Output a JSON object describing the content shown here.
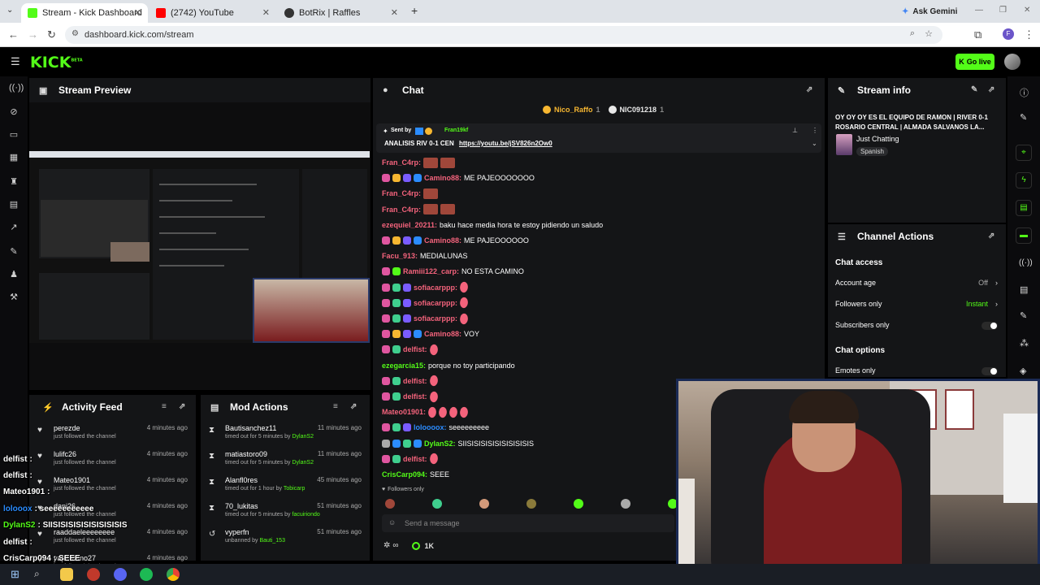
{
  "browser": {
    "tabs": [
      {
        "label": "Stream - Kick Dashboard",
        "color": "#53fc18"
      },
      {
        "label": "(2742) YouTube",
        "color": "#ff0000"
      },
      {
        "label": "BotRix | Raffles",
        "color": "#333333"
      }
    ],
    "new_tab": "+",
    "ask_gemini": "Ask Gemini",
    "url": "dashboard.kick.com/stream"
  },
  "header": {
    "logo": "KICK",
    "logo_beta": "BETA",
    "go_live": "Go live"
  },
  "preview": {
    "title": "Stream Preview"
  },
  "activity": {
    "title": "Activity Feed",
    "items": [
      {
        "name": "perezde",
        "sub": "just followed the channel",
        "time": "4 minutes ago"
      },
      {
        "name": "lulifc26",
        "sub": "just followed the channel",
        "time": "4 minutes ago"
      },
      {
        "name": "Mateo1901",
        "sub": "just followed the channel",
        "time": "4 minutes ago"
      },
      {
        "name": "dani26",
        "sub": "just followed the channel",
        "time": "4 minutes ago"
      },
      {
        "name": "raaddaeleeeeeeee",
        "sub": "just followed the channel",
        "time": "4 minutes ago"
      },
      {
        "name": "yapemano27",
        "sub": "just followed the channel",
        "time": "4 minutes ago"
      }
    ]
  },
  "mod": {
    "title": "Mod Actions",
    "items": [
      {
        "name": "Bautisanchez11",
        "sub": "timed out for 5 minutes by",
        "who": "DylanS2",
        "time": "11 minutes ago",
        "icon": "⧗"
      },
      {
        "name": "matiastoro09",
        "sub": "timed out for 5 minutes by",
        "who": "DylanS2",
        "time": "11 minutes ago",
        "icon": "⧗"
      },
      {
        "name": "Alanfl0res",
        "sub": "timed out for 1 hour by",
        "who": "Tobicarp",
        "time": "45 minutes ago",
        "icon": "⧗"
      },
      {
        "name": "70_lukitas",
        "sub": "timed out for 5 minutes by",
        "who": "facuiriondo",
        "time": "51 minutes ago",
        "icon": "⧗"
      },
      {
        "name": "vyperfn",
        "sub": "unbanned by",
        "who": "Bauti_153",
        "time": "51 minutes ago",
        "icon": "↺"
      }
    ]
  },
  "chat": {
    "title": "Chat",
    "top_gifters": [
      {
        "name": "Nico_Raffo",
        "count": "1",
        "color": "#f7b731"
      },
      {
        "name": "NIC091218",
        "count": "1",
        "color": "#e8e8e8"
      }
    ],
    "pinned": {
      "sent_by": "Sent by",
      "author": "Fran19kf",
      "text": "ANALISIS RIV 0-1 CEN",
      "link": "https://youtu.be/jSV826n2Ow0"
    },
    "messages": [
      {
        "user": "Fran_C4rp:",
        "color": "#f4637c",
        "text": "",
        "badges": [],
        "emotes": 2
      },
      {
        "user": "Camino88:",
        "color": "#f4637c",
        "text": "ME PAJEOOOOOOO",
        "badges": [
          "#e056a0",
          "#f7b731",
          "#7a5cff",
          "#2b8cff"
        ],
        "emotes": 0
      },
      {
        "user": "Fran_C4rp:",
        "color": "#f4637c",
        "text": "",
        "badges": [],
        "emotes": 1
      },
      {
        "user": "Fran_C4rp:",
        "color": "#f4637c",
        "text": "",
        "badges": [],
        "emotes": 2
      },
      {
        "user": "ezequiel_20211:",
        "color": "#f4637c",
        "text": "baku hace media hora te estoy pidiendo un saludo",
        "badges": [],
        "emotes": 0
      },
      {
        "user": "Camino88:",
        "color": "#f4637c",
        "text": "ME PAJEOOOOOO",
        "badges": [
          "#e056a0",
          "#f7b731",
          "#7a5cff",
          "#2b8cff"
        ],
        "emotes": 0
      },
      {
        "user": "Facu_913:",
        "color": "#f4637c",
        "text": "MEDIALUNAS",
        "badges": [],
        "emotes": 0
      },
      {
        "user": "Ramiii122_carp:",
        "color": "#f4637c",
        "text": "NO ESTA CAMINO",
        "badges": [
          "#e056a0",
          "#53fc18"
        ],
        "emotes": 0
      },
      {
        "user": "sofiacarppp:",
        "color": "#f4637c",
        "text": "",
        "badges": [
          "#e056a0",
          "#3fcf8e",
          "#7a5cff"
        ],
        "emotes": 1
      },
      {
        "user": "sofiacarppp:",
        "color": "#f4637c",
        "text": "",
        "badges": [
          "#e056a0",
          "#3fcf8e",
          "#7a5cff"
        ],
        "emotes": 1
      },
      {
        "user": "sofiacarppp:",
        "color": "#f4637c",
        "text": "",
        "badges": [
          "#e056a0",
          "#3fcf8e",
          "#7a5cff"
        ],
        "emotes": 1
      },
      {
        "user": "Camino88:",
        "color": "#f4637c",
        "text": "VOY",
        "badges": [
          "#e056a0",
          "#f7b731",
          "#7a5cff",
          "#2b8cff"
        ],
        "emotes": 0
      },
      {
        "user": "delfist:",
        "color": "#f4637c",
        "text": "",
        "badges": [
          "#e056a0",
          "#3fcf8e"
        ],
        "emotes": 1
      },
      {
        "user": "ezegarcia15:",
        "color": "#53fc18",
        "text": "porque no toy participando",
        "badges": [],
        "emotes": 0
      },
      {
        "user": "delfist:",
        "color": "#f4637c",
        "text": "",
        "badges": [
          "#e056a0",
          "#3fcf8e"
        ],
        "emotes": 1
      },
      {
        "user": "delfist:",
        "color": "#f4637c",
        "text": "",
        "badges": [
          "#e056a0",
          "#3fcf8e"
        ],
        "emotes": 1
      },
      {
        "user": "Mateo01901:",
        "color": "#f4637c",
        "text": "",
        "badges": [],
        "emotes": 4
      },
      {
        "user": "loloooox:",
        "color": "#2b8cff",
        "text": "seeeeeeeee",
        "badges": [
          "#e056a0",
          "#3fcf8e",
          "#7a5cff"
        ],
        "emotes": 0
      },
      {
        "user": "DylanS2:",
        "color": "#53fc18",
        "text": "SIISISISISISISISISISIS",
        "badges": [
          "#aaaaaa",
          "#2b8cff",
          "#3fcf8e",
          "#2b8cff"
        ],
        "emotes": 0
      },
      {
        "user": "delfist:",
        "color": "#f4637c",
        "text": "",
        "badges": [
          "#e056a0",
          "#3fcf8e"
        ],
        "emotes": 1
      },
      {
        "user": "CrisCarp094:",
        "color": "#53fc18",
        "text": "SEEE",
        "badges": [],
        "emotes": 0
      }
    ],
    "followers_only": "Followers only",
    "send_placeholder": "Send a message",
    "viewers_icon": "∞",
    "count": "1K"
  },
  "stream_info": {
    "title": "Stream info",
    "stream_title": "OY OY OY ES EL EQUIPO DE RAMON | RIVER 0-1 ROSARIO CENTRAL | ALMADA SALVANOS LA...",
    "category": "Just Chatting",
    "language": "Spanish"
  },
  "channel_actions": {
    "title": "Channel Actions",
    "chat_access": "Chat access",
    "account_age": "Account age",
    "account_age_val": "Off",
    "followers_only": "Followers only",
    "followers_only_val": "Instant",
    "subscribers_only": "Subscribers only",
    "chat_options": "Chat options",
    "emotes_only": "Emotes only"
  },
  "overlay_chat": [
    {
      "user": "delfist",
      "text": ":",
      "color": "#ffffff"
    },
    {
      "user": "delfist",
      "text": ":",
      "color": "#ffffff"
    },
    {
      "user": "Mateo1901",
      "text": ":",
      "color": "#ffffff"
    },
    {
      "user": "lolooox",
      "text": ": seeeeeeeeeee",
      "color": "#2b8cff"
    },
    {
      "user": "DylanS2",
      "text": ": SIISISISISISISISISISIS",
      "color": "#53fc18"
    },
    {
      "user": "delfist",
      "text": ":",
      "color": "#ffffff"
    },
    {
      "user": "CrisCarp094",
      "text": ": SEEE",
      "color": "#ffffff"
    }
  ]
}
